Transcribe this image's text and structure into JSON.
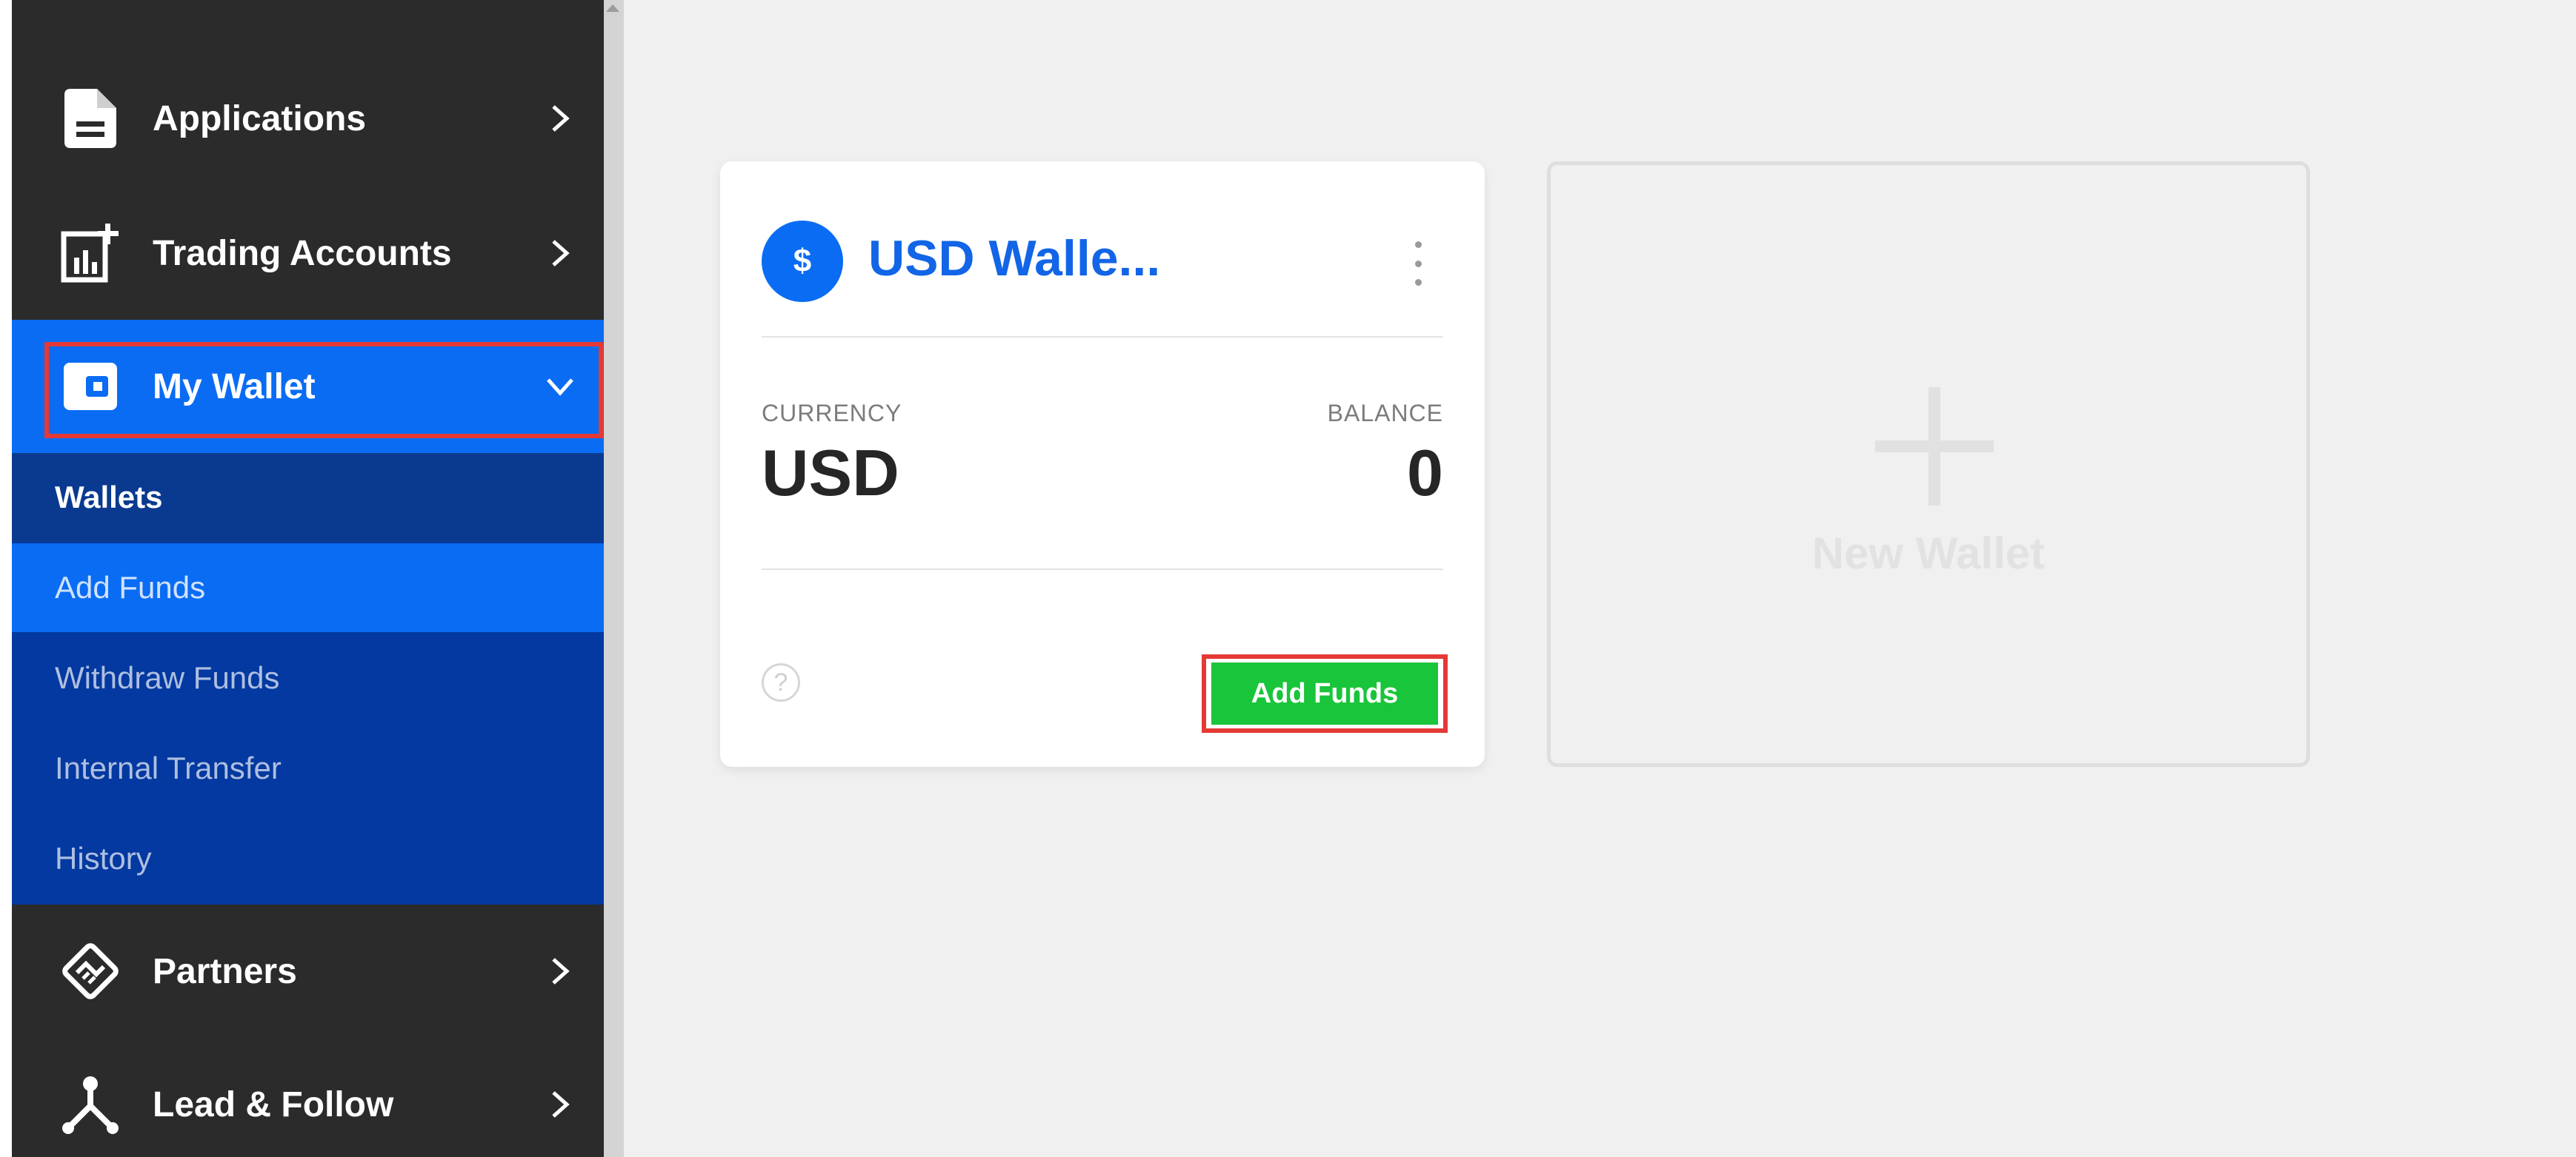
{
  "sidebar": {
    "items": [
      {
        "label": "Applications",
        "icon": "document-icon"
      },
      {
        "label": "Trading Accounts",
        "icon": "chart-plus-icon"
      },
      {
        "label": "My Wallet",
        "icon": "wallet-icon",
        "expanded": true
      },
      {
        "label": "Partners",
        "icon": "handshake-icon"
      },
      {
        "label": "Lead & Follow",
        "icon": "network-icon"
      }
    ],
    "submenu": [
      {
        "label": "Wallets"
      },
      {
        "label": "Add Funds"
      },
      {
        "label": "Withdraw Funds"
      },
      {
        "label": "Internal Transfer"
      },
      {
        "label": "History"
      }
    ]
  },
  "wallet_card": {
    "icon_symbol": "$",
    "title": "USD Walle...",
    "currency_label": "CURRENCY",
    "currency_value": "USD",
    "balance_label": "BALANCE",
    "balance_value": "0",
    "help_symbol": "?",
    "add_funds_label": "Add Funds"
  },
  "new_wallet": {
    "label": "New Wallet"
  },
  "colors": {
    "sidebar_bg": "#2b2b2b",
    "active_blue": "#0a6cf3",
    "submenu_bg": "#0339a0",
    "accent_green": "#19c53a",
    "highlight_red": "#e53935"
  }
}
